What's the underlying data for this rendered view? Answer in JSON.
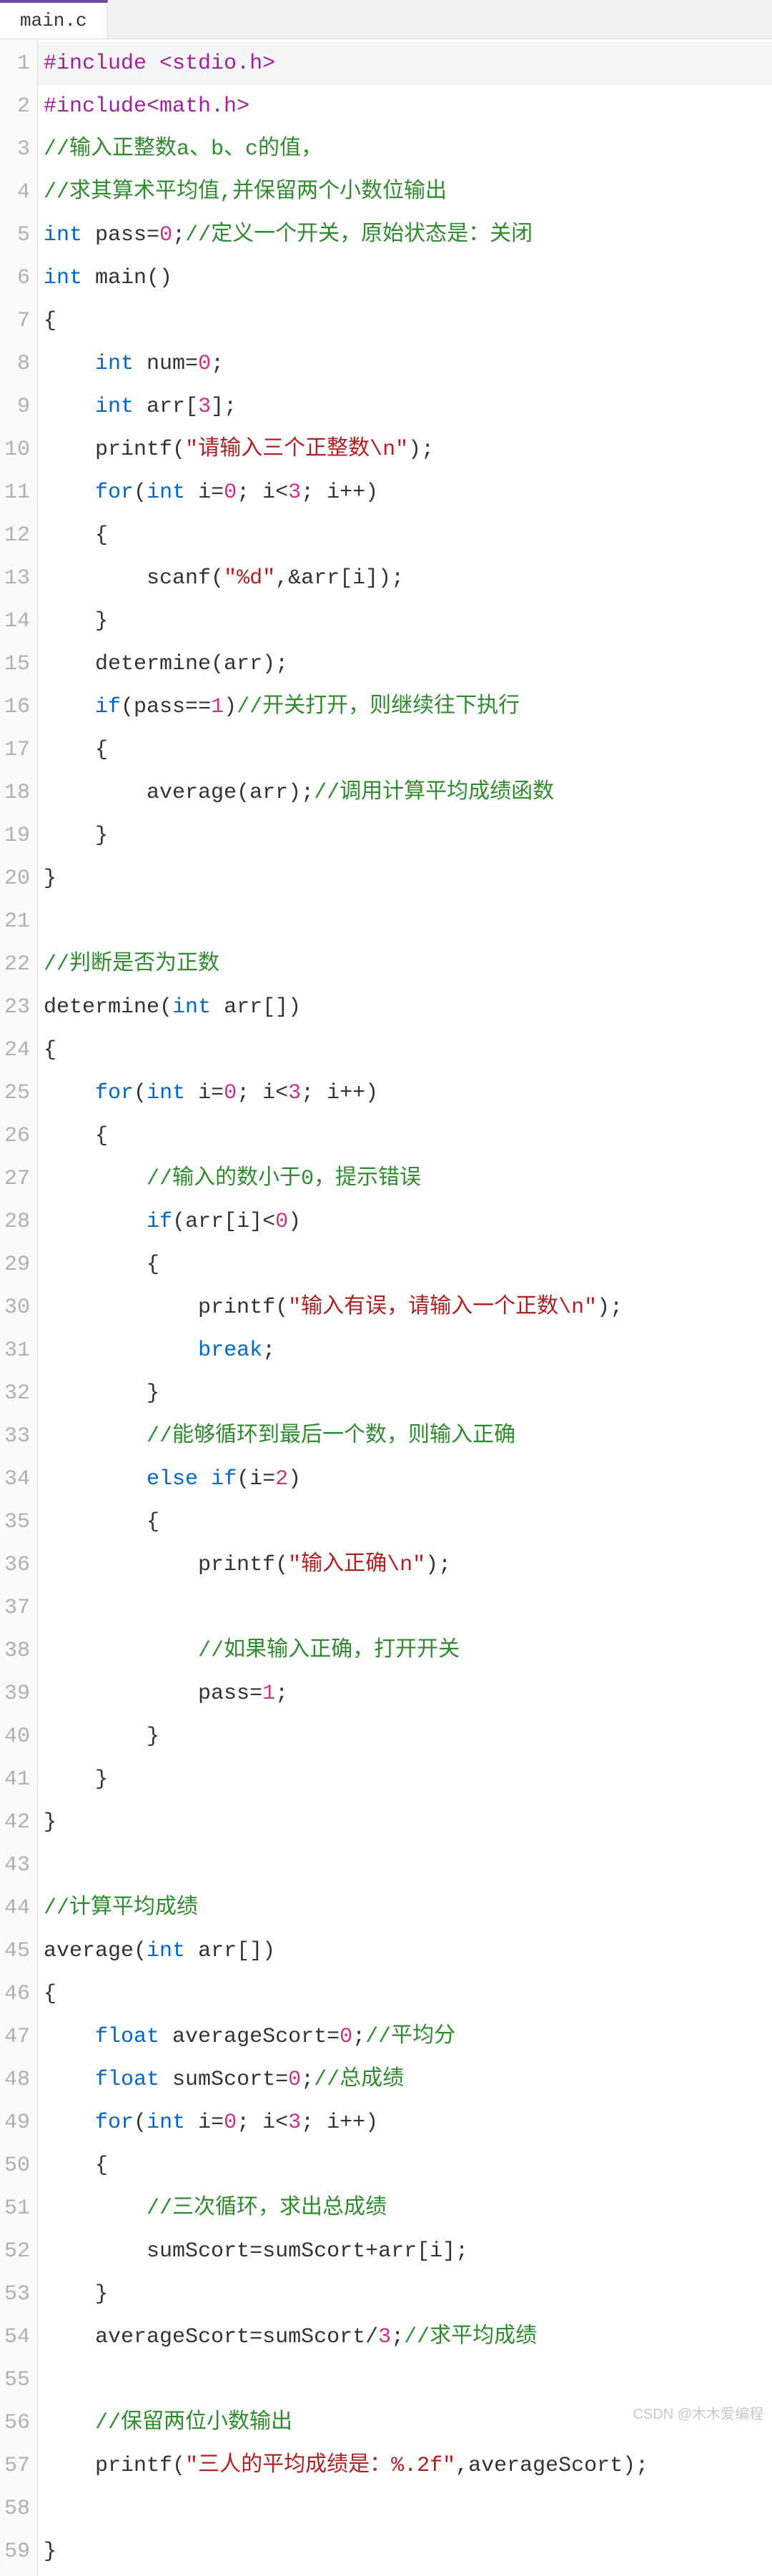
{
  "tab": {
    "filename": "main.c"
  },
  "watermark": "CSDN @木木爱编程",
  "colors": {
    "tab_accent": "#6b4ba0",
    "preproc": "#a020a0",
    "keyword": "#0066cc",
    "comment": "#2e8b2e",
    "string": "#b02020",
    "number": "#cc3388"
  },
  "lines": [
    {
      "n": 1,
      "current": true,
      "tokens": [
        [
          "pp",
          "#include <stdio.h>"
        ]
      ]
    },
    {
      "n": 2,
      "tokens": [
        [
          "pp",
          "#include<math.h>"
        ]
      ]
    },
    {
      "n": 3,
      "tokens": [
        [
          "cm",
          "//输入正整数a、b、c的值，"
        ]
      ]
    },
    {
      "n": 4,
      "tokens": [
        [
          "cm",
          "//求其算术平均值,并保留两个小数位输出"
        ]
      ]
    },
    {
      "n": 5,
      "tokens": [
        [
          "kw",
          "int"
        ],
        [
          "id",
          " pass="
        ],
        [
          "num",
          "0"
        ],
        [
          "id",
          ";"
        ],
        [
          "cm",
          "//定义一个开关，原始状态是：关闭"
        ]
      ]
    },
    {
      "n": 6,
      "tokens": [
        [
          "kw",
          "int"
        ],
        [
          "id",
          " main()"
        ]
      ]
    },
    {
      "n": 7,
      "tokens": [
        [
          "id",
          "{"
        ]
      ]
    },
    {
      "n": 8,
      "tokens": [
        [
          "id",
          "    "
        ],
        [
          "kw",
          "int"
        ],
        [
          "id",
          " num="
        ],
        [
          "num",
          "0"
        ],
        [
          "id",
          ";"
        ]
      ]
    },
    {
      "n": 9,
      "tokens": [
        [
          "id",
          "    "
        ],
        [
          "kw",
          "int"
        ],
        [
          "id",
          " arr["
        ],
        [
          "num",
          "3"
        ],
        [
          "id",
          "];"
        ]
      ]
    },
    {
      "n": 10,
      "tokens": [
        [
          "id",
          "    printf("
        ],
        [
          "str",
          "\"请输入三个正整数\\n\""
        ],
        [
          "id",
          ");"
        ]
      ]
    },
    {
      "n": 11,
      "tokens": [
        [
          "id",
          "    "
        ],
        [
          "kw",
          "for"
        ],
        [
          "id",
          "("
        ],
        [
          "kw",
          "int"
        ],
        [
          "id",
          " i="
        ],
        [
          "num",
          "0"
        ],
        [
          "id",
          "; i<"
        ],
        [
          "num",
          "3"
        ],
        [
          "id",
          "; i++)"
        ]
      ]
    },
    {
      "n": 12,
      "tokens": [
        [
          "id",
          "    {"
        ]
      ]
    },
    {
      "n": 13,
      "tokens": [
        [
          "id",
          "        scanf("
        ],
        [
          "str",
          "\"%d\""
        ],
        [
          "id",
          ",&arr[i]);"
        ]
      ]
    },
    {
      "n": 14,
      "tokens": [
        [
          "id",
          "    }"
        ]
      ]
    },
    {
      "n": 15,
      "tokens": [
        [
          "id",
          "    determine(arr);"
        ]
      ]
    },
    {
      "n": 16,
      "tokens": [
        [
          "id",
          "    "
        ],
        [
          "kw",
          "if"
        ],
        [
          "id",
          "(pass=="
        ],
        [
          "num",
          "1"
        ],
        [
          "id",
          ")"
        ],
        [
          "cm",
          "//开关打开，则继续往下执行"
        ]
      ]
    },
    {
      "n": 17,
      "tokens": [
        [
          "id",
          "    {"
        ]
      ]
    },
    {
      "n": 18,
      "tokens": [
        [
          "id",
          "        average(arr);"
        ],
        [
          "cm",
          "//调用计算平均成绩函数"
        ]
      ]
    },
    {
      "n": 19,
      "tokens": [
        [
          "id",
          "    }"
        ]
      ]
    },
    {
      "n": 20,
      "tokens": [
        [
          "id",
          "}"
        ]
      ]
    },
    {
      "n": 21,
      "tokens": [
        [
          "id",
          ""
        ]
      ]
    },
    {
      "n": 22,
      "tokens": [
        [
          "cm",
          "//判断是否为正数"
        ]
      ]
    },
    {
      "n": 23,
      "tokens": [
        [
          "id",
          "determine("
        ],
        [
          "kw",
          "int"
        ],
        [
          "id",
          " arr[])"
        ]
      ]
    },
    {
      "n": 24,
      "tokens": [
        [
          "id",
          "{"
        ]
      ]
    },
    {
      "n": 25,
      "tokens": [
        [
          "id",
          "    "
        ],
        [
          "kw",
          "for"
        ],
        [
          "id",
          "("
        ],
        [
          "kw",
          "int"
        ],
        [
          "id",
          " i="
        ],
        [
          "num",
          "0"
        ],
        [
          "id",
          "; i<"
        ],
        [
          "num",
          "3"
        ],
        [
          "id",
          "; i++)"
        ]
      ]
    },
    {
      "n": 26,
      "tokens": [
        [
          "id",
          "    {"
        ]
      ]
    },
    {
      "n": 27,
      "tokens": [
        [
          "id",
          "        "
        ],
        [
          "cm",
          "//输入的数小于0，提示错误"
        ]
      ]
    },
    {
      "n": 28,
      "tokens": [
        [
          "id",
          "        "
        ],
        [
          "kw",
          "if"
        ],
        [
          "id",
          "(arr[i]<"
        ],
        [
          "num",
          "0"
        ],
        [
          "id",
          ")"
        ]
      ]
    },
    {
      "n": 29,
      "tokens": [
        [
          "id",
          "        {"
        ]
      ]
    },
    {
      "n": 30,
      "tokens": [
        [
          "id",
          "            printf("
        ],
        [
          "str",
          "\"输入有误，请输入一个正数\\n\""
        ],
        [
          "id",
          ");"
        ]
      ]
    },
    {
      "n": 31,
      "tokens": [
        [
          "id",
          "            "
        ],
        [
          "kw",
          "break"
        ],
        [
          "id",
          ";"
        ]
      ]
    },
    {
      "n": 32,
      "tokens": [
        [
          "id",
          "        }"
        ]
      ]
    },
    {
      "n": 33,
      "tokens": [
        [
          "id",
          "        "
        ],
        [
          "cm",
          "//能够循环到最后一个数，则输入正确"
        ]
      ]
    },
    {
      "n": 34,
      "tokens": [
        [
          "id",
          "        "
        ],
        [
          "kw",
          "else"
        ],
        [
          "id",
          " "
        ],
        [
          "kw",
          "if"
        ],
        [
          "id",
          "(i="
        ],
        [
          "num",
          "2"
        ],
        [
          "id",
          ")"
        ]
      ]
    },
    {
      "n": 35,
      "tokens": [
        [
          "id",
          "        {"
        ]
      ]
    },
    {
      "n": 36,
      "tokens": [
        [
          "id",
          "            printf("
        ],
        [
          "str",
          "\"输入正确\\n\""
        ],
        [
          "id",
          ");"
        ]
      ]
    },
    {
      "n": 37,
      "tokens": [
        [
          "id",
          ""
        ]
      ]
    },
    {
      "n": 38,
      "tokens": [
        [
          "id",
          "            "
        ],
        [
          "cm",
          "//如果输入正确，打开开关"
        ]
      ]
    },
    {
      "n": 39,
      "tokens": [
        [
          "id",
          "            pass="
        ],
        [
          "num",
          "1"
        ],
        [
          "id",
          ";"
        ]
      ]
    },
    {
      "n": 40,
      "tokens": [
        [
          "id",
          "        }"
        ]
      ]
    },
    {
      "n": 41,
      "tokens": [
        [
          "id",
          "    }"
        ]
      ]
    },
    {
      "n": 42,
      "tokens": [
        [
          "id",
          "}"
        ]
      ]
    },
    {
      "n": 43,
      "tokens": [
        [
          "id",
          ""
        ]
      ]
    },
    {
      "n": 44,
      "tokens": [
        [
          "cm",
          "//计算平均成绩"
        ]
      ]
    },
    {
      "n": 45,
      "tokens": [
        [
          "id",
          "average("
        ],
        [
          "kw",
          "int"
        ],
        [
          "id",
          " arr[])"
        ]
      ]
    },
    {
      "n": 46,
      "tokens": [
        [
          "id",
          "{"
        ]
      ]
    },
    {
      "n": 47,
      "tokens": [
        [
          "id",
          "    "
        ],
        [
          "kw",
          "float"
        ],
        [
          "id",
          " averageScort="
        ],
        [
          "num",
          "0"
        ],
        [
          "id",
          ";"
        ],
        [
          "cm",
          "//平均分"
        ]
      ]
    },
    {
      "n": 48,
      "tokens": [
        [
          "id",
          "    "
        ],
        [
          "kw",
          "float"
        ],
        [
          "id",
          " sumScort="
        ],
        [
          "num",
          "0"
        ],
        [
          "id",
          ";"
        ],
        [
          "cm",
          "//总成绩"
        ]
      ]
    },
    {
      "n": 49,
      "tokens": [
        [
          "id",
          "    "
        ],
        [
          "kw",
          "for"
        ],
        [
          "id",
          "("
        ],
        [
          "kw",
          "int"
        ],
        [
          "id",
          " i="
        ],
        [
          "num",
          "0"
        ],
        [
          "id",
          "; i<"
        ],
        [
          "num",
          "3"
        ],
        [
          "id",
          "; i++)"
        ]
      ]
    },
    {
      "n": 50,
      "tokens": [
        [
          "id",
          "    {"
        ]
      ]
    },
    {
      "n": 51,
      "tokens": [
        [
          "id",
          "        "
        ],
        [
          "cm",
          "//三次循环，求出总成绩"
        ]
      ]
    },
    {
      "n": 52,
      "tokens": [
        [
          "id",
          "        sumScort=sumScort+arr[i];"
        ]
      ]
    },
    {
      "n": 53,
      "tokens": [
        [
          "id",
          "    }"
        ]
      ]
    },
    {
      "n": 54,
      "tokens": [
        [
          "id",
          "    averageScort=sumScort/"
        ],
        [
          "num",
          "3"
        ],
        [
          "id",
          ";"
        ],
        [
          "cm",
          "//求平均成绩"
        ]
      ]
    },
    {
      "n": 55,
      "tokens": [
        [
          "id",
          ""
        ]
      ]
    },
    {
      "n": 56,
      "tokens": [
        [
          "id",
          "    "
        ],
        [
          "cm",
          "//保留两位小数输出"
        ]
      ]
    },
    {
      "n": 57,
      "tokens": [
        [
          "id",
          "    printf("
        ],
        [
          "str",
          "\"三人的平均成绩是：%.2f\""
        ],
        [
          "id",
          ",averageScort);"
        ]
      ]
    },
    {
      "n": 58,
      "tokens": [
        [
          "id",
          ""
        ]
      ]
    },
    {
      "n": 59,
      "tokens": [
        [
          "id",
          "}"
        ]
      ]
    }
  ]
}
